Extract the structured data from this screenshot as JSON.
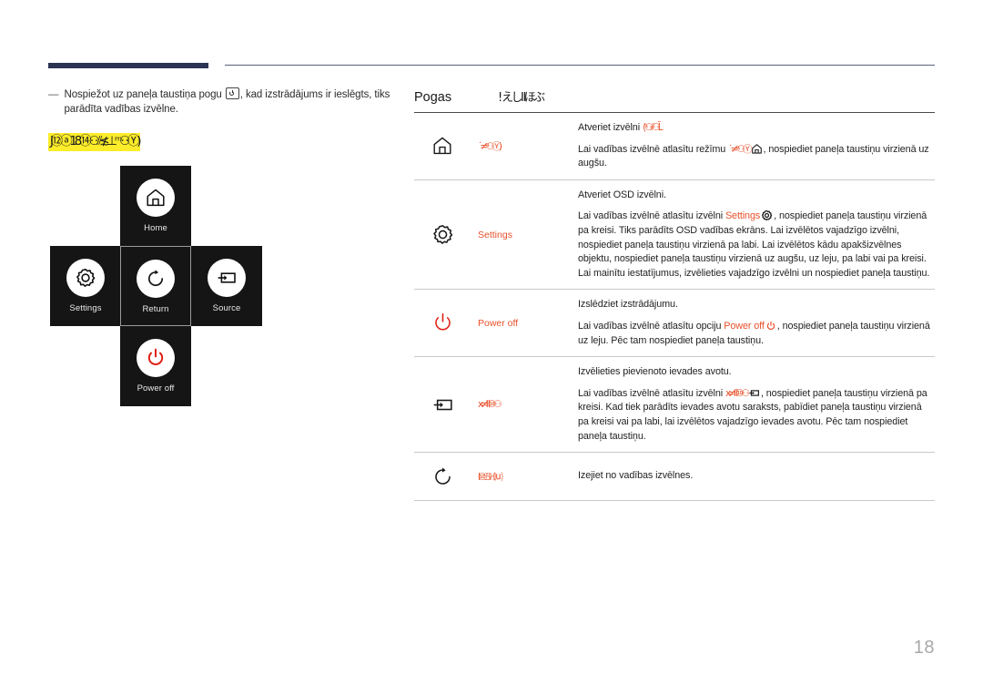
{
  "header": {
    "rule_accent_color": "#2b3553",
    "rule_line_color": "#5b5f77"
  },
  "note": {
    "dash": "—",
    "text_before": "Nospiežot uz paneļa taustiņa pogu",
    "text_after": ", kad izstrādājums ir ieslēgts, tiks parādīta vadības izvēlne.",
    "icon": "power-button-icon",
    "highlighted_garbled": "J⑫ⓐ18⑭⚇⫽≴⊥ᵐ⚇Ⓨ)",
    "highlight_color": "#fcec2a"
  },
  "key_diagram": {
    "tiles": [
      {
        "id": "home",
        "label": "Home",
        "icon": "home-icon",
        "accent": "#1a1a1a"
      },
      {
        "id": "settings",
        "label": "Settings",
        "icon": "gear-icon",
        "accent": "#1a1a1a"
      },
      {
        "id": "return",
        "label": "Return",
        "icon": "return-icon",
        "accent": "#1a1a1a"
      },
      {
        "id": "source",
        "label": "Source",
        "icon": "source-icon",
        "accent": "#1a1a1a"
      },
      {
        "id": "poweroff",
        "label": "Power off",
        "icon": "power-icon",
        "accent": "#e01f12"
      }
    ]
  },
  "table": {
    "head": {
      "col1": "Pogas",
      "col2_garbled": "! えしⅡほぶ"
    },
    "rows": [
      {
        "icon": "home-icon",
        "label_garbled": "˙ ≠ⁿ⚇Ⓨ)",
        "line1_text": "Atveriet izvēlni",
        "line1_garbled": "⟨ⁿ⚇⫽⚇L̆",
        "line2_before": "Lai vadības izvēlnē atlasītu režīmu",
        "line2_garbled": "˙ ≠ⁿ⚇Ⓨ",
        "line2_icon": "home-icon",
        "line2_after": ", nospiediet paneļa taustiņu virzienā uz augšu."
      },
      {
        "icon": "gear-icon",
        "label": "Settings",
        "line1_text": "Atveriet OSD izvēlni.",
        "line2_before": "Lai vadības izvēlnē atlasītu izvēlni",
        "line2_orange": "Settings",
        "line2_icon": "gear-icon",
        "line2_after": ", nospiediet paneļa taustiņu virzienā pa kreisi. Tiks parādīts OSD vadības ekrāns. Lai izvēlētos vajadzīgo izvēlni, nospiediet paneļa taustiņu virzienā pa labi. Lai izvēlētos kādu apakšizvēlnes objektu, nospiediet paneļa taustiņu virzienā uz augšu, uz leju, pa labi vai pa kreisi. Lai mainītu iestatījumus, izvēlieties vajadzīgo izvēlni un nospiediet paneļa taustiņu."
      },
      {
        "icon": "power-icon",
        "label": "Power off",
        "line1_text": "Izslēdziet izstrādājumu.",
        "line2_before": "Lai vadības izvēlnē atlasītu opciju",
        "line2_orange": "Power off",
        "line2_icon": "power-icon",
        "line2_after": ", nospiediet paneļa taustiņu virzienā uz leju. Pēc tam nospiediet paneļa taustiņu."
      },
      {
        "icon": "source-icon",
        "label_garbled": "x≠Ⅱ⑩⚇",
        "line1_text": "Izvēlieties pievienoto ievades avotu.",
        "line2_before": "Lai vadības izvēlnē atlasītu izvēlni",
        "line2_garbled": "x≠Ⅱ⑩⚇",
        "line2_icon": "source-icon",
        "line2_after": ", nospiediet paneļa taustiņu virzienā pa kreisi. Kad tiek parādīts ievades avotu saraksts, pabīdiet paneļa taustiņu virzienā pa kreisi vai pa labi, lai izvēlētos vajadzīgo ievades avotu. Pēc tam nospiediet paneļa taustiņu."
      },
      {
        "icon": "return-icon",
        "label_garbled": "I⑩ℬℍ⒰",
        "line1_text": "Izejiet no vadības izvēlnes."
      }
    ]
  },
  "footer": {
    "page_number": "18"
  }
}
